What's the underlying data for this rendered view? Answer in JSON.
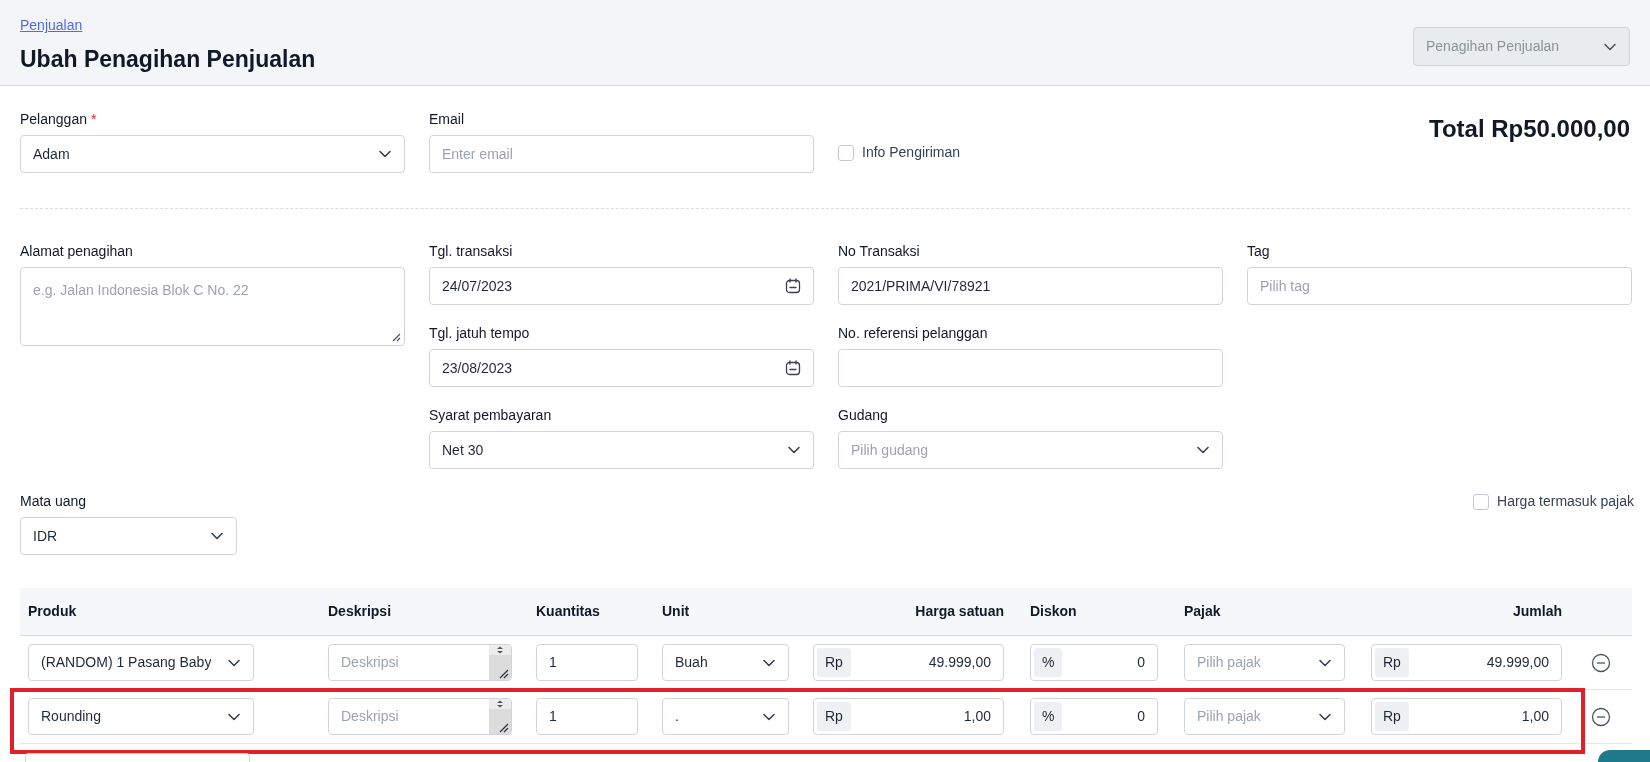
{
  "header": {
    "breadcrumb": "Penjualan",
    "title": "Ubah Penagihan Penjualan",
    "type_select": {
      "value": "Penagihan Penjualan",
      "disabled": true
    }
  },
  "customer": {
    "label": "Pelanggan",
    "required_mark": "*",
    "value": "Adam"
  },
  "email": {
    "label": "Email",
    "placeholder": "Enter email"
  },
  "shipping_info": {
    "label": "Info Pengiriman",
    "checked": false
  },
  "total": "Total Rp50.000,00",
  "form_columns": [
    [
      {
        "kind": "textarea",
        "label": "Alamat penagihan",
        "placeholder": "e.g. Jalan Indonesia Blok C No. 22"
      }
    ],
    [
      {
        "kind": "date",
        "label": "Tgl. transaksi",
        "value": "24/07/2023"
      },
      {
        "kind": "date",
        "label": "Tgl. jatuh tempo",
        "value": "23/08/2023"
      },
      {
        "kind": "select",
        "label": "Syarat pembayaran",
        "value": "Net 30"
      }
    ],
    [
      {
        "kind": "text",
        "label": "No Transaksi",
        "value": "2021/PRIMA/VI/78921"
      },
      {
        "kind": "text",
        "label": "No. referensi pelanggan"
      },
      {
        "kind": "select",
        "label": "Gudang",
        "placeholder": "Pilih gudang"
      }
    ],
    [
      {
        "kind": "text",
        "label": "Tag",
        "placeholder": "Pilih tag"
      }
    ]
  ],
  "currency": {
    "label": "Mata uang",
    "value": "IDR"
  },
  "tax_inclusive": {
    "label": "Harga termasuk pajak",
    "checked": false
  },
  "table": {
    "columns": [
      {
        "label": "Produk",
        "kind": "text"
      },
      {
        "label": "Deskripsi",
        "kind": "text"
      },
      {
        "label": "Kuantitas",
        "kind": "text"
      },
      {
        "label": "Unit",
        "kind": "text"
      },
      {
        "label": "Harga satuan",
        "kind": "money"
      },
      {
        "label": "Diskon",
        "kind": "text"
      },
      {
        "label": "Pajak",
        "kind": "text"
      },
      {
        "label": "Jumlah",
        "kind": "money"
      }
    ],
    "rows": [
      {
        "product": "(RANDOM) 1 Pasang Baby",
        "description_placeholder": "Deskripsi",
        "quantity": "1",
        "unit": "Buah",
        "price_prefix": "Rp",
        "price": "49.999,00",
        "discount_prefix": "%",
        "discount": "0",
        "tax_placeholder": "Pilih pajak",
        "amount_prefix": "Rp",
        "amount": "49.999,00",
        "highlighted": false
      },
      {
        "product": "Rounding",
        "description_placeholder": "Deskripsi",
        "quantity": "1",
        "unit": ".",
        "price_prefix": "Rp",
        "price": "1,00",
        "discount_prefix": "%",
        "discount": "0",
        "tax_placeholder": "Pilih pajak",
        "amount_prefix": "Rp",
        "amount": "1,00",
        "highlighted": true
      }
    ]
  }
}
